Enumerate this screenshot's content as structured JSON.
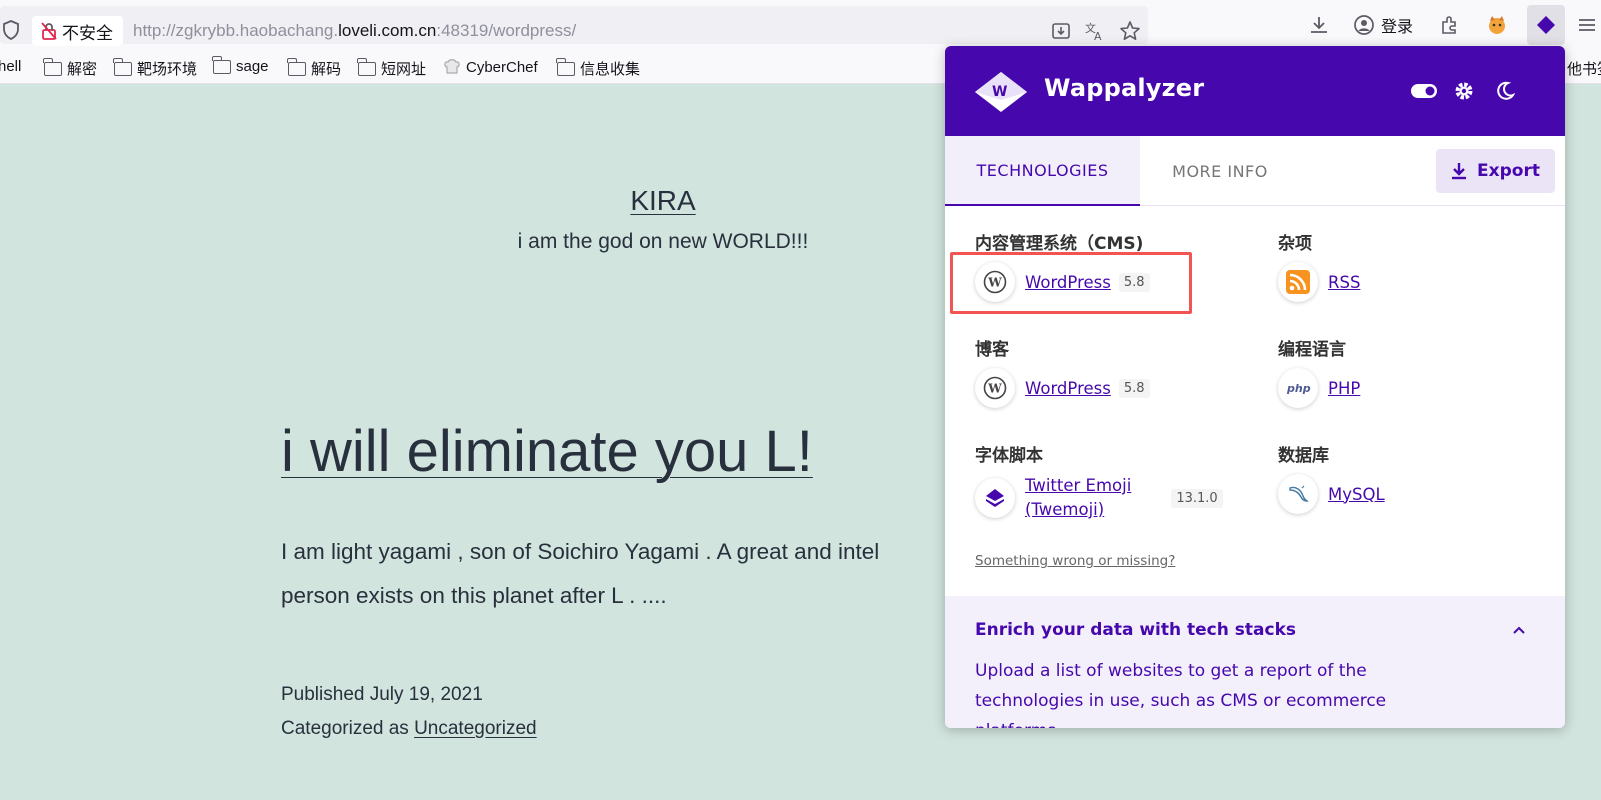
{
  "browser": {
    "security_label": "不安全",
    "url_prefix": "http://zgkrybb.haobachang.",
    "url_host": "loveli.com.cn",
    "url_suffix": ":48319/wordpress/",
    "login_label": "登录"
  },
  "bookmarks": [
    {
      "label": "hell"
    },
    {
      "label": "解密"
    },
    {
      "label": "靶场环境"
    },
    {
      "label": "sage"
    },
    {
      "label": "解码"
    },
    {
      "label": "短网址"
    },
    {
      "label": "CyberChef"
    },
    {
      "label": "信息收集"
    }
  ],
  "bookmarks_overflow": "他书签",
  "page": {
    "site_title": "KIRA",
    "site_description": "i am the god on new WORLD!!!",
    "post_title": "i will eliminate you L!",
    "post_excerpt": "I am light yagami , son of Soichiro Yagami . A great and intel",
    "post_excerpt_line2": "person exists on this planet after L . ....",
    "published": "Published July 19, 2021",
    "categorized_prefix": "Categorized as",
    "category": "Uncategorized"
  },
  "wappalyzer": {
    "brand": "Wappalyzer",
    "accent_color": "#4608ad",
    "tabs": {
      "technologies": "TECHNOLOGIES",
      "more_info": "MORE INFO"
    },
    "export_label": "Export",
    "categories": [
      {
        "name": "内容管理系统（CMS)",
        "tech": "WordPress",
        "version": "5.8",
        "icon": "wordpress-icon"
      },
      {
        "name": "杂项",
        "tech": "RSS",
        "version": "",
        "icon": "rss-icon"
      },
      {
        "name": "博客",
        "tech": "WordPress",
        "version": "5.8",
        "icon": "wordpress-icon"
      },
      {
        "name": "编程语言",
        "tech": "PHP",
        "version": "",
        "icon": "php-icon"
      },
      {
        "name": "字体脚本",
        "tech": "Twitter Emoji (Twemoji)",
        "tech_line1": "Twitter Emoji",
        "tech_line2": "(Twemoji)",
        "version": "13.1.0",
        "icon": "twemoji-icon"
      },
      {
        "name": "数据库",
        "tech": "MySQL",
        "version": "",
        "icon": "mysql-icon"
      }
    ],
    "wrong_link": "Something wrong or missing?",
    "enrich_title": "Enrich your data with tech stacks",
    "enrich_text": "Upload a list of websites to get a report of the technologies in use, such as CMS or ecommerce platforms."
  }
}
